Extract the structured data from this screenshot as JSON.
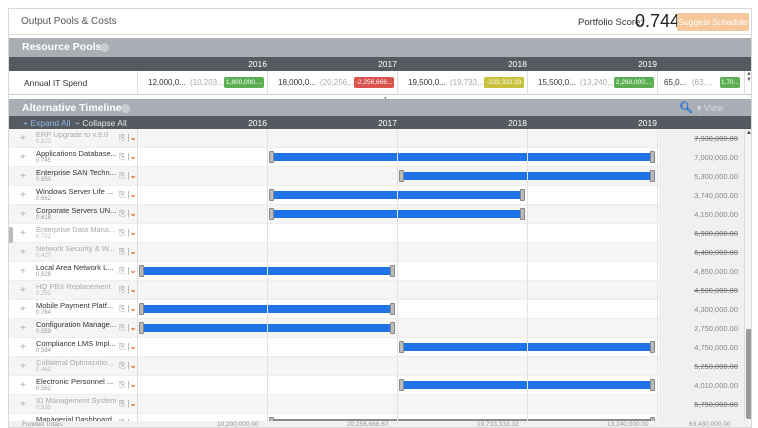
{
  "app": {
    "title": "Output Pools & Costs"
  },
  "score": {
    "label": "Portfolio Score:",
    "value": "0.744"
  },
  "suggest_button": "Suggest Schedule",
  "resource_pools": {
    "title": "Resource Pools",
    "years": [
      "2016",
      "2017",
      "2018",
      "2019"
    ],
    "row": {
      "name": "Annual IT Spend",
      "cells": [
        {
          "value": "12,000,0...",
          "paren": "(10,203....",
          "badge": "1,800,000....",
          "badge_color": "green"
        },
        {
          "value": "18,000,0...",
          "paren": "(20,256,...",
          "badge": "-2,256,666...",
          "badge_color": "red"
        },
        {
          "value": "19,500,0...",
          "paren": "(19,733,...",
          "badge": "-233,333.33",
          "badge_color": "yellow"
        },
        {
          "value": "15,500,0...",
          "paren": "(13,240,...",
          "badge": "2,260,000....",
          "badge_color": "green"
        },
        {
          "value": "65,0...",
          "paren": "(63,...",
          "badge": "1,70...",
          "badge_color": "green"
        }
      ]
    }
  },
  "timeline": {
    "title": "Alternative Timeline",
    "expand_label": "Expand All",
    "collapse_label": "Collapse All",
    "view_options": "View Options",
    "years": [
      "2016",
      "2017",
      "2018",
      "2019"
    ],
    "projects": [
      {
        "name": "ERP Upgrade to v.9.0",
        "score": "0.623",
        "cost": "7,330,000.00",
        "enabled": false,
        "bar": null
      },
      {
        "name": "Applications Database...",
        "score": "0.745",
        "cost": "7,000,000.00",
        "enabled": true,
        "bar": {
          "start": 2017.0,
          "end": 2020.0,
          "color": "blue"
        }
      },
      {
        "name": "Enterprise SAN Techn...",
        "score": "0.650",
        "cost": "5,300,000.00",
        "enabled": true,
        "bar": {
          "start": 2018.0,
          "end": 2020.0,
          "color": "blue"
        }
      },
      {
        "name": "Windows Server Life ...",
        "score": "0.662",
        "cost": "3,740,000.00",
        "enabled": true,
        "bar": {
          "start": 2017.0,
          "end": 2019.0,
          "color": "blue"
        }
      },
      {
        "name": "Corporate Servers UN...",
        "score": "0.618",
        "cost": "4,150,000.00",
        "enabled": true,
        "bar": {
          "start": 2017.0,
          "end": 2019.0,
          "color": "blue"
        }
      },
      {
        "name": "Enterprise Data Mana...",
        "score": "0.722",
        "cost": "6,900,000.00",
        "enabled": false,
        "bar": null
      },
      {
        "name": "Network Security & W...",
        "score": "0.427",
        "cost": "6,400,000.00",
        "enabled": false,
        "bar": null
      },
      {
        "name": "Local Area Network L...",
        "score": "0.628",
        "cost": "4,850,000.00",
        "enabled": true,
        "bar": {
          "start": 2016.0,
          "end": 2018.0,
          "color": "blue"
        }
      },
      {
        "name": "HQ PBX Replacement",
        "score": "0.252",
        "cost": "4,500,000.00",
        "enabled": false,
        "bar": null
      },
      {
        "name": "Mobile Payment Platf...",
        "score": "0.764",
        "cost": "4,300,000.00",
        "enabled": true,
        "bar": {
          "start": 2016.0,
          "end": 2018.0,
          "color": "blue"
        }
      },
      {
        "name": "Configuration Manage...",
        "score": "0.559",
        "cost": "2,750,000.00",
        "enabled": true,
        "bar": {
          "start": 2016.0,
          "end": 2018.0,
          "color": "blue"
        }
      },
      {
        "name": "Compliance LMS Impl...",
        "score": "0.584",
        "cost": "4,750,000.00",
        "enabled": true,
        "bar": {
          "start": 2018.0,
          "end": 2020.0,
          "color": "blue"
        }
      },
      {
        "name": "Collateral Optimizatio...",
        "score": "0.462",
        "cost": "5,250,000.00",
        "enabled": false,
        "bar": null
      },
      {
        "name": "Electronic Personnel ...",
        "score": "0.562",
        "cost": "4,010,000.00",
        "enabled": true,
        "bar": {
          "start": 2018.0,
          "end": 2020.0,
          "color": "blue"
        }
      },
      {
        "name": "ID Management System",
        "score": "0.535",
        "cost": "5,750,000.00",
        "enabled": false,
        "bar": null
      },
      {
        "name": "Managerial Dashboard",
        "score": "0.171",
        "cost": "7,500,000.00",
        "enabled": true,
        "bar": {
          "start": 2017.0,
          "end": 2020.0,
          "color": "gray"
        }
      }
    ]
  },
  "footer": {
    "label": "Funded Totals",
    "values": [
      "10,200,000.00",
      "20,256,666.67",
      "19,733,333.33",
      "13,240,000.00",
      "63,430,000.00"
    ]
  },
  "colors": {
    "accent": "#1f73e8",
    "suggest": "#f6c79a",
    "header": "#a9adb4",
    "dark_bar": "#555a60"
  }
}
